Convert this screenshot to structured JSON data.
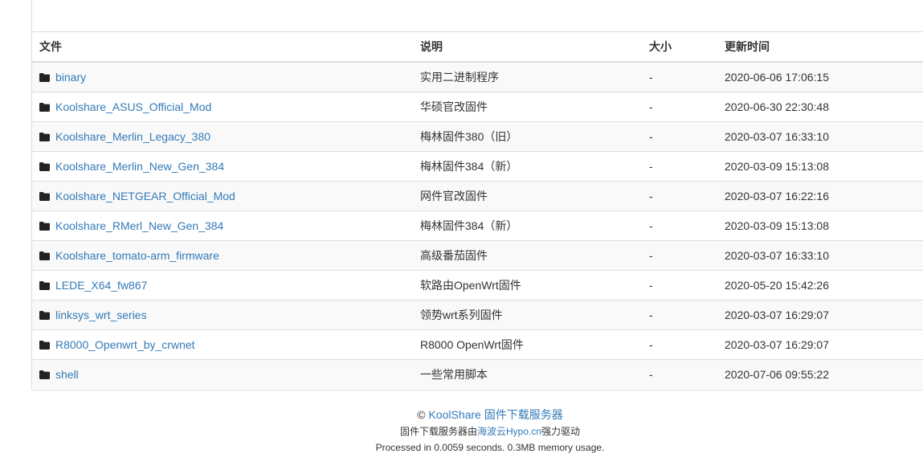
{
  "table": {
    "headers": {
      "name": "文件",
      "desc": "说明",
      "size": "大小",
      "time": "更新时间"
    },
    "rows": [
      {
        "name": "binary",
        "desc": "实用二进制程序",
        "size": "-",
        "time": "2020-06-06 17:06:15"
      },
      {
        "name": "Koolshare_ASUS_Official_Mod",
        "desc": "华硕官改固件",
        "size": "-",
        "time": "2020-06-30 22:30:48"
      },
      {
        "name": "Koolshare_Merlin_Legacy_380",
        "desc": "梅林固件380（旧）",
        "size": "-",
        "time": "2020-03-07 16:33:10"
      },
      {
        "name": "Koolshare_Merlin_New_Gen_384",
        "desc": "梅林固件384（新）",
        "size": "-",
        "time": "2020-03-09 15:13:08"
      },
      {
        "name": "Koolshare_NETGEAR_Official_Mod",
        "desc": "网件官改固件",
        "size": "-",
        "time": "2020-03-07 16:22:16"
      },
      {
        "name": "Koolshare_RMerl_New_Gen_384",
        "desc": "梅林固件384（新）",
        "size": "-",
        "time": "2020-03-09 15:13:08"
      },
      {
        "name": "Koolshare_tomato-arm_firmware",
        "desc": "高级番茄固件",
        "size": "-",
        "time": "2020-03-07 16:33:10"
      },
      {
        "name": "LEDE_X64_fw867",
        "desc": "软路由OpenWrt固件",
        "size": "-",
        "time": "2020-05-20 15:42:26"
      },
      {
        "name": "linksys_wrt_series",
        "desc": "领势wrt系列固件",
        "size": "-",
        "time": "2020-03-07 16:29:07"
      },
      {
        "name": "R8000_Openwrt_by_crwnet",
        "desc": "R8000 OpenWrt固件",
        "size": "-",
        "time": "2020-03-07 16:29:07"
      },
      {
        "name": "shell",
        "desc": "一些常用脚本",
        "size": "-",
        "time": "2020-07-06 09:55:22"
      }
    ]
  },
  "footer": {
    "copyright_symbol": "©",
    "site_link": "KoolShare 固件下载服务器",
    "powered_prefix": "固件下载服务器由",
    "powered_link": "海波云Hypo.cn",
    "powered_suffix": "强力驱动",
    "stats": "Processed in 0.0059 seconds. 0.3MB memory usage."
  },
  "icons": {
    "folder": "folder-icon"
  },
  "colors": {
    "link": "#337ab7",
    "stripe": "#f9f9f9",
    "border": "#dddddd"
  }
}
